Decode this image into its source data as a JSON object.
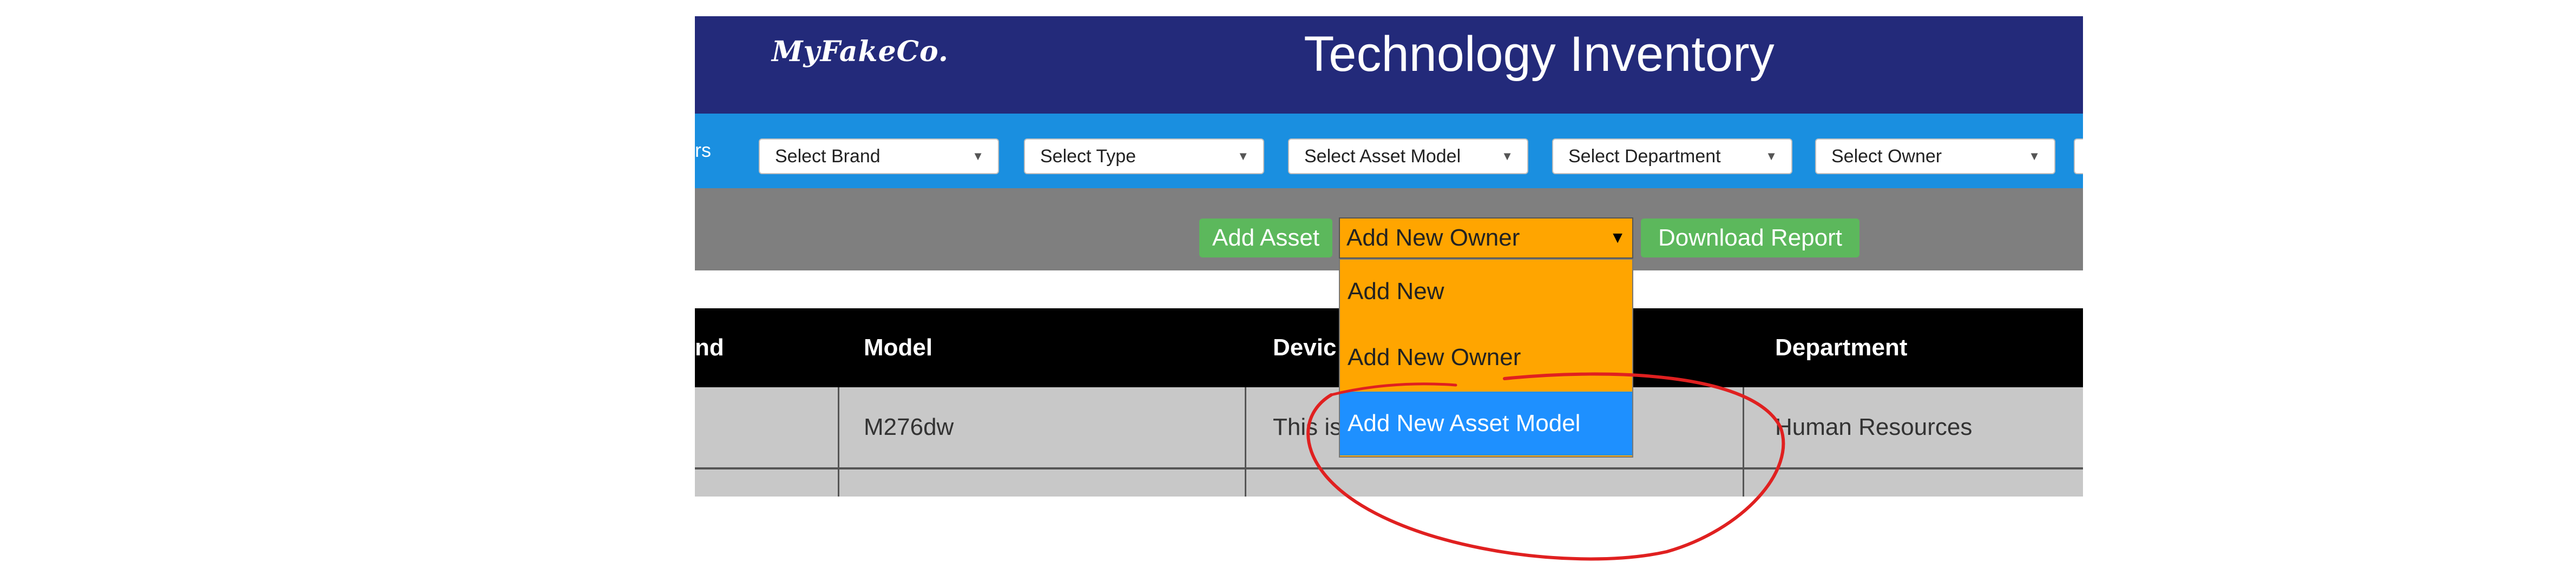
{
  "header": {
    "logo": "MyFakeCo.",
    "title": "Technology Inventory",
    "background_color": "#232a7a"
  },
  "filters": {
    "label": "rs",
    "select_brand": "Select Brand",
    "select_type": "Select Type",
    "select_asset_model": "Select Asset Model",
    "select_department": "Select Department",
    "select_owner": "Select Owner",
    "caret_icon": "triangle-down",
    "background_color": "#1a8fe0"
  },
  "actions": {
    "add_asset": "Add Asset",
    "add_new_select": {
      "selected": "Add New Owner",
      "options": [
        "Add New",
        "Add New Owner",
        "Add New Asset Model"
      ],
      "highlighted_option": "Add New Asset Model",
      "background_color": "#ffa500",
      "highlight_color": "#1e90ff"
    },
    "download_report": "Download Report",
    "button_color": "#5cb85c"
  },
  "table": {
    "headers": [
      "nd",
      "Model",
      "Devic",
      "Department"
    ],
    "rows": [
      [
        "",
        "M276dw",
        "This is",
        "Human Resources"
      ]
    ]
  },
  "annotation": {
    "shape": "hand-drawn ellipse",
    "color": "#e02020"
  }
}
